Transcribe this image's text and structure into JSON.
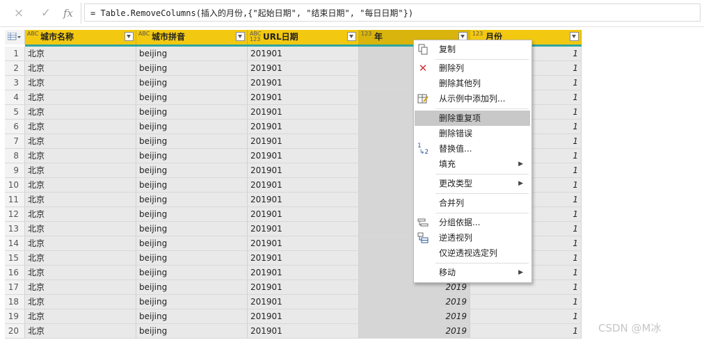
{
  "formula_bar": {
    "cancel_icon": "×",
    "confirm_icon": "✓",
    "fx_label": "fx",
    "formula": "= Table.RemoveColumns(插入的月份,{\"起始日期\", \"结束日期\", \"每日日期\"})"
  },
  "table": {
    "columns": [
      {
        "type": "ABC",
        "label": "城市名称"
      },
      {
        "type": "ABC",
        "label": "城市拼音"
      },
      {
        "type": "ABC 123",
        "label": "URL日期"
      },
      {
        "type": "123",
        "label": "年"
      },
      {
        "type": "123",
        "label": "月份"
      }
    ],
    "rows": [
      {
        "n": "1",
        "city": "北京",
        "pinyin": "beijing",
        "url": "201901",
        "year": "",
        "month": "1"
      },
      {
        "n": "2",
        "city": "北京",
        "pinyin": "beijing",
        "url": "201901",
        "year": "",
        "month": "1"
      },
      {
        "n": "3",
        "city": "北京",
        "pinyin": "beijing",
        "url": "201901",
        "year": "",
        "month": "1"
      },
      {
        "n": "4",
        "city": "北京",
        "pinyin": "beijing",
        "url": "201901",
        "year": "",
        "month": "1"
      },
      {
        "n": "5",
        "city": "北京",
        "pinyin": "beijing",
        "url": "201901",
        "year": "",
        "month": "1"
      },
      {
        "n": "6",
        "city": "北京",
        "pinyin": "beijing",
        "url": "201901",
        "year": "",
        "month": "1"
      },
      {
        "n": "7",
        "city": "北京",
        "pinyin": "beijing",
        "url": "201901",
        "year": "",
        "month": "1"
      },
      {
        "n": "8",
        "city": "北京",
        "pinyin": "beijing",
        "url": "201901",
        "year": "",
        "month": "1"
      },
      {
        "n": "9",
        "city": "北京",
        "pinyin": "beijing",
        "url": "201901",
        "year": "",
        "month": "1"
      },
      {
        "n": "10",
        "city": "北京",
        "pinyin": "beijing",
        "url": "201901",
        "year": "",
        "month": "1"
      },
      {
        "n": "11",
        "city": "北京",
        "pinyin": "beijing",
        "url": "201901",
        "year": "",
        "month": "1"
      },
      {
        "n": "12",
        "city": "北京",
        "pinyin": "beijing",
        "url": "201901",
        "year": "",
        "month": "1"
      },
      {
        "n": "13",
        "city": "北京",
        "pinyin": "beijing",
        "url": "201901",
        "year": "",
        "month": "1"
      },
      {
        "n": "14",
        "city": "北京",
        "pinyin": "beijing",
        "url": "201901",
        "year": "",
        "month": "1"
      },
      {
        "n": "15",
        "city": "北京",
        "pinyin": "beijing",
        "url": "201901",
        "year": "",
        "month": "1"
      },
      {
        "n": "16",
        "city": "北京",
        "pinyin": "beijing",
        "url": "201901",
        "year": "",
        "month": "1"
      },
      {
        "n": "17",
        "city": "北京",
        "pinyin": "beijing",
        "url": "201901",
        "year": "2019",
        "month": "1"
      },
      {
        "n": "18",
        "city": "北京",
        "pinyin": "beijing",
        "url": "201901",
        "year": "2019",
        "month": "1"
      },
      {
        "n": "19",
        "city": "北京",
        "pinyin": "beijing",
        "url": "201901",
        "year": "2019",
        "month": "1"
      },
      {
        "n": "20",
        "city": "北京",
        "pinyin": "beijing",
        "url": "201901",
        "year": "2019",
        "month": "1"
      }
    ]
  },
  "context_menu": {
    "items": [
      {
        "label": "复制",
        "icon": "copy-icon",
        "submenu": false
      },
      {
        "label": "删除列",
        "icon": "delete-icon",
        "submenu": false
      },
      {
        "label": "删除其他列",
        "icon": "",
        "submenu": false
      },
      {
        "label": "从示例中添加列...",
        "icon": "add-from-example-icon",
        "submenu": false
      },
      {
        "label": "删除重复项",
        "icon": "",
        "submenu": false,
        "highlighted": true
      },
      {
        "label": "删除错误",
        "icon": "",
        "submenu": false
      },
      {
        "label": "替换值...",
        "icon": "replace-values-icon",
        "submenu": false
      },
      {
        "label": "填充",
        "icon": "",
        "submenu": true
      },
      {
        "label": "更改类型",
        "icon": "",
        "submenu": true
      },
      {
        "label": "合并列",
        "icon": "",
        "submenu": false
      },
      {
        "label": "分组依据...",
        "icon": "group-by-icon",
        "submenu": false
      },
      {
        "label": "逆透视列",
        "icon": "unpivot-icon",
        "submenu": false
      },
      {
        "label": "仅逆透视选定列",
        "icon": "",
        "submenu": false
      },
      {
        "label": "移动",
        "icon": "",
        "submenu": true
      }
    ]
  },
  "watermark": "CSDN @M冰",
  "colors": {
    "header": "#f2c811",
    "quality_bar": "#2ea49f",
    "menu_highlight": "#c8c8c8"
  }
}
